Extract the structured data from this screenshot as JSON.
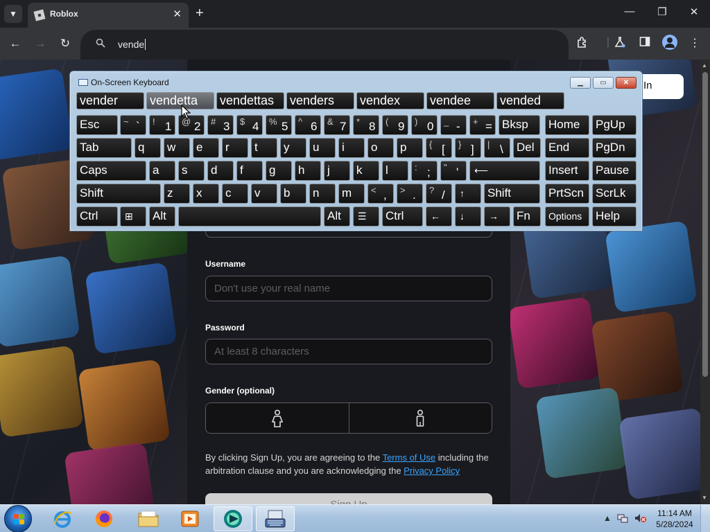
{
  "browser": {
    "tab_title": "Roblox",
    "tab_close": "✕",
    "new_tab": "+",
    "omnibox_text": "vende"
  },
  "page": {
    "login_label": "In",
    "username_label": "Username",
    "username_placeholder": "Don't use your real name",
    "password_label": "Password",
    "password_placeholder": "At least 8 characters",
    "gender_label": "Gender (optional)",
    "legal_prefix": "By clicking Sign Up, you are agreeing to the ",
    "terms_link": "Terms of Use",
    "legal_middle": " including the arbitration clause and you are acknowledging the ",
    "privacy_link": "Privacy Policy",
    "signup_label": "Sign Up"
  },
  "osk": {
    "title": "On-Screen Keyboard",
    "predictions": [
      "vender",
      "vendetta",
      "vendettas",
      "venders",
      "vendex",
      "vendee",
      "vended"
    ],
    "keys": [
      {
        "label": "Esc"
      },
      {
        "sup": "~",
        "main": "`"
      },
      {
        "sup": "!",
        "main": "1"
      },
      {
        "sup": "@",
        "main": "2"
      },
      {
        "sup": "#",
        "main": "3"
      },
      {
        "sup": "$",
        "main": "4"
      },
      {
        "sup": "%",
        "main": "5"
      },
      {
        "sup": "^",
        "main": "6"
      },
      {
        "sup": "&",
        "main": "7"
      },
      {
        "sup": "*",
        "main": "8"
      },
      {
        "sup": "(",
        "main": "9"
      },
      {
        "sup": ")",
        "main": "0"
      },
      {
        "sup": "_",
        "main": "-"
      },
      {
        "sup": "+",
        "main": "="
      },
      {
        "label": "Bksp"
      },
      {
        "label": "Home"
      },
      {
        "label": "PgUp"
      },
      {
        "label": "Tab"
      },
      {
        "label": "q"
      },
      {
        "label": "w"
      },
      {
        "label": "e"
      },
      {
        "label": "r"
      },
      {
        "label": "t"
      },
      {
        "label": "y"
      },
      {
        "label": "u"
      },
      {
        "label": "i"
      },
      {
        "label": "o"
      },
      {
        "label": "p"
      },
      {
        "sup": "{",
        "main": "["
      },
      {
        "sup": "}",
        "main": "]"
      },
      {
        "sup": "|",
        "main": "\\"
      },
      {
        "label": "Del"
      },
      {
        "label": "End"
      },
      {
        "label": "PgDn"
      },
      {
        "label": "Caps"
      },
      {
        "label": "a"
      },
      {
        "label": "s"
      },
      {
        "label": "d"
      },
      {
        "label": "f"
      },
      {
        "label": "g"
      },
      {
        "label": "h"
      },
      {
        "label": "j"
      },
      {
        "label": "k"
      },
      {
        "label": "l"
      },
      {
        "sup": ":",
        "main": ";"
      },
      {
        "sup": "\"",
        "main": "'"
      },
      {
        "label": "⟵"
      },
      {
        "label": "Insert"
      },
      {
        "label": "Pause"
      },
      {
        "label": "Shift"
      },
      {
        "label": "z"
      },
      {
        "label": "x"
      },
      {
        "label": "c"
      },
      {
        "label": "v"
      },
      {
        "label": "b"
      },
      {
        "label": "n"
      },
      {
        "label": "m"
      },
      {
        "sup": "<",
        "main": ","
      },
      {
        "sup": ">",
        "main": "."
      },
      {
        "sup": "?",
        "main": "/"
      },
      {
        "label": "↑"
      },
      {
        "label": "Shift"
      },
      {
        "label": "PrtScn"
      },
      {
        "label": "ScrLk"
      },
      {
        "label": "Ctrl"
      },
      {
        "label": "⊞"
      },
      {
        "label": "Alt"
      },
      {
        "label": ""
      },
      {
        "label": "Alt"
      },
      {
        "label": "☰"
      },
      {
        "label": "Ctrl"
      },
      {
        "label": "←"
      },
      {
        "label": "↓"
      },
      {
        "label": "→"
      },
      {
        "label": "Fn"
      },
      {
        "label": "Options"
      },
      {
        "label": "Help"
      }
    ]
  },
  "taskbar": {
    "time": "11:14 AM",
    "date": "5/28/2024"
  }
}
